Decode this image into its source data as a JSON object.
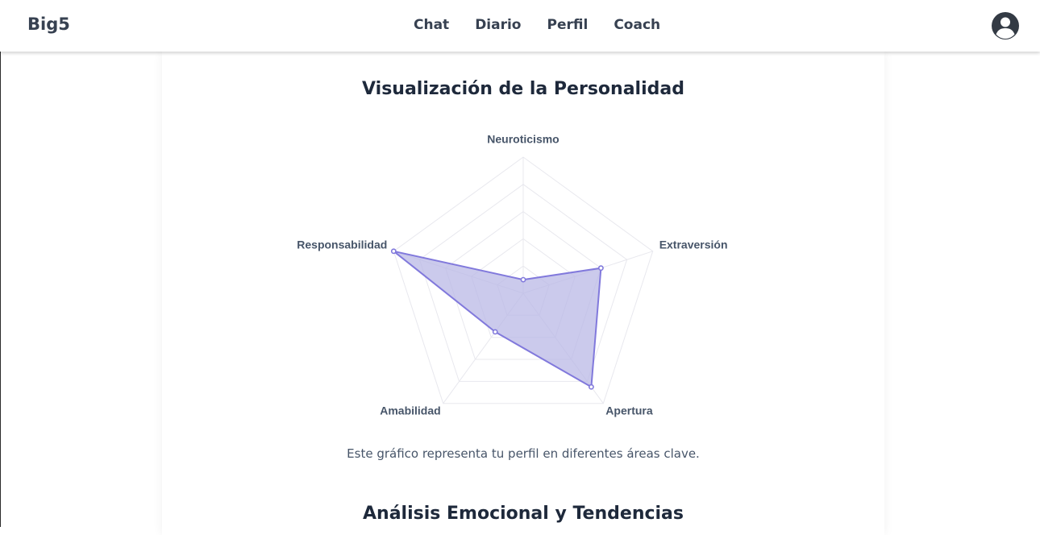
{
  "header": {
    "brand": "Big5",
    "nav": [
      {
        "label": "Chat"
      },
      {
        "label": "Diario"
      },
      {
        "label": "Perfil"
      },
      {
        "label": "Coach"
      }
    ],
    "avatar_icon": "user-circle-icon"
  },
  "main": {
    "radar_title": "Visualización de la Personalidad",
    "caption": "Este gráfico representa tu perfil en diferentes áreas clave.",
    "emotion_title": "Análisis Emocional y Tendencias"
  },
  "colors": {
    "fill": "#b9b8e6",
    "stroke": "#8179dc",
    "grid": "#e8e8ee"
  },
  "chart_data": {
    "type": "radar",
    "axes": [
      "Neuroticismo",
      "Extraversión",
      "Apertura",
      "Amabilidad",
      "Responsabilidad"
    ],
    "values": [
      0.1,
      0.6,
      0.85,
      0.35,
      1.0
    ],
    "rlim": [
      0,
      1
    ],
    "rings": 5,
    "grid": true
  }
}
